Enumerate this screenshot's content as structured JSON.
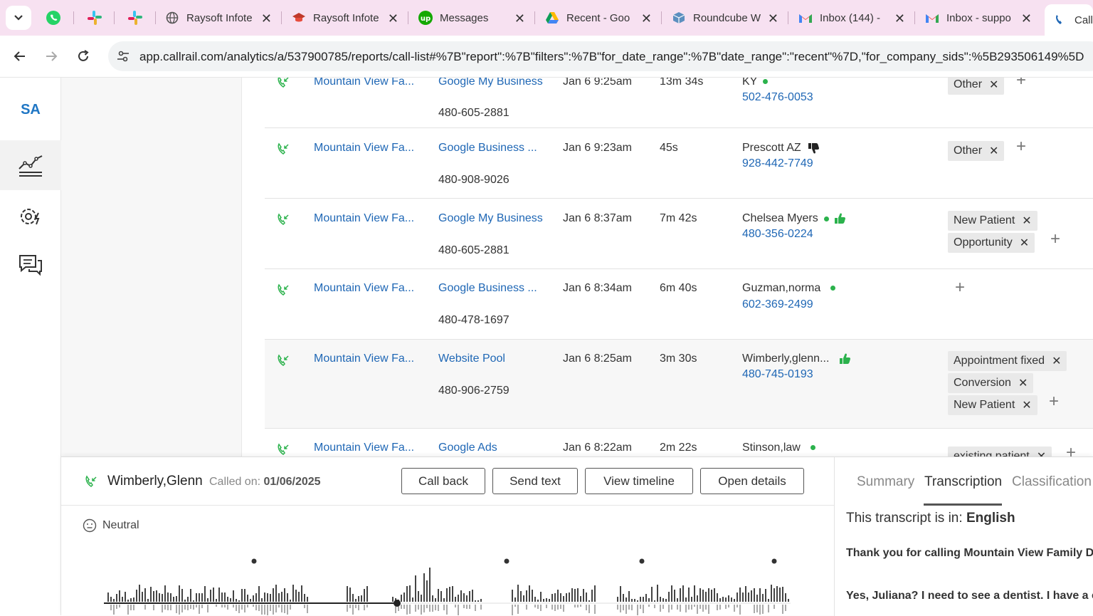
{
  "browser": {
    "tabs": [
      {
        "label": "Raysoft Infote",
        "icon": "globe-icon"
      },
      {
        "label": "Raysoft Infote",
        "icon": "graduation-cap-icon"
      },
      {
        "label": "Messages",
        "icon": "upwork-icon"
      },
      {
        "label": "Recent - Goo",
        "icon": "google-drive-icon"
      },
      {
        "label": "Roundcube W",
        "icon": "roundcube-icon"
      },
      {
        "label": "Inbox (144) -",
        "icon": "gmail-icon"
      },
      {
        "label": "Inbox - suppo",
        "icon": "gmail-icon"
      },
      {
        "label": "Call",
        "icon": "callrail-icon"
      }
    ],
    "url": "app.callrail.com/analytics/a/537900785/reports/call-list#%7B\"report\":%7B\"filters\":%7B\"for_date_range\":%7B\"date_range\":\"recent\"%7D,\"for_company_sids\":%5B293506149%5D"
  },
  "rail": {
    "brand": "SA"
  },
  "calls": [
    {
      "company": "Mountain View Fa...",
      "source": "Google My Business",
      "tracking": "480-605-2881",
      "datetime": "Jan 6 9:25am",
      "duration": "13m 34s",
      "caller": "KY",
      "caller_indicator": "dot",
      "phone": "502-476-0053",
      "tags": [
        "Other"
      ]
    },
    {
      "company": "Mountain View Fa...",
      "source": "Google Business ...",
      "tracking": "480-908-9026",
      "datetime": "Jan 6 9:23am",
      "duration": "45s",
      "caller": "Prescott AZ",
      "caller_indicator": "thumbs-down",
      "phone": "928-442-7749",
      "tags": [
        "Other"
      ]
    },
    {
      "company": "Mountain View Fa...",
      "source": "Google My Business",
      "tracking": "480-605-2881",
      "datetime": "Jan 6 8:37am",
      "duration": "7m 42s",
      "caller": "Chelsea Myers",
      "caller_indicator": "dot-thumbs-up",
      "phone": "480-356-0224",
      "tags": [
        "New Patient",
        "Opportunity"
      ]
    },
    {
      "company": "Mountain View Fa...",
      "source": "Google Business ...",
      "tracking": "480-478-1697",
      "datetime": "Jan 6 8:34am",
      "duration": "6m 40s",
      "caller": "Guzman,norma",
      "caller_indicator": "dot",
      "phone": "602-369-2499",
      "tags": []
    },
    {
      "company": "Mountain View Fa...",
      "source": "Website Pool",
      "tracking": "480-906-2759",
      "datetime": "Jan 6 8:25am",
      "duration": "3m 30s",
      "caller": "Wimberly,glenn...",
      "caller_indicator": "thumbs-up",
      "phone": "480-745-0193",
      "tags": [
        "Appointment fixed",
        "Conversion",
        "New Patient"
      ]
    },
    {
      "company": "Mountain View Fa...",
      "source": "Google Ads",
      "tracking": "",
      "datetime": "Jan 6 8:22am",
      "duration": "2m 22s",
      "caller": "Stinson,law",
      "caller_indicator": "dot",
      "phone": "",
      "tags": [
        "existing patient"
      ]
    }
  ],
  "detail": {
    "caller_name": "Wimberly,Glenn",
    "called_on_label": "Called on:",
    "called_on_value": "01/06/2025",
    "buttons": {
      "call_back": "Call back",
      "send_text": "Send text",
      "view_timeline": "View timeline",
      "open_details": "Open details"
    },
    "sentiment": "Neutral",
    "tabs": {
      "summary": "Summary",
      "transcription": "Transcription",
      "classification": "Classification"
    },
    "language_label": "This transcript is in:",
    "language_value": "English",
    "transcript": [
      "Thank you for calling Mountain View Family De",
      "Yes, Juliana? I need to see a dentist. I have a cra"
    ]
  },
  "colors": {
    "link": "#1f67b5",
    "positive": "#2bb24c",
    "tabstrip": "#f7e1f1"
  }
}
